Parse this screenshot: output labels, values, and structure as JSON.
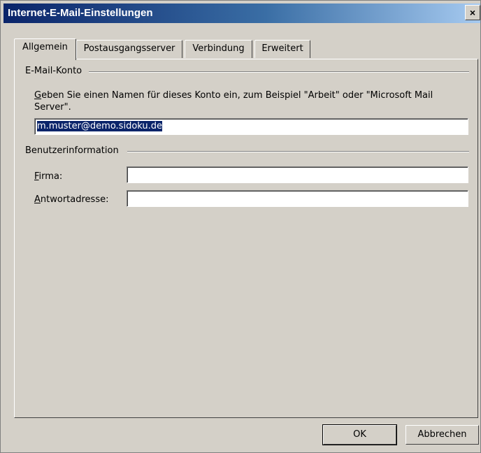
{
  "window": {
    "title": "Internet-E-Mail-Einstellungen",
    "close_symbol": "×"
  },
  "tabs": [
    {
      "label": "Allgemein",
      "active": true
    },
    {
      "label": "Postausgangsserver",
      "active": false
    },
    {
      "label": "Verbindung",
      "active": false
    },
    {
      "label": "Erweitert",
      "active": false
    }
  ],
  "account_group": {
    "label": "E-Mail-Konto",
    "description_first_letter": "G",
    "description_rest": "eben Sie einen Namen für dieses Konto ein, zum Beispiel \"Arbeit\" oder \"Microsoft Mail Server\".",
    "account_name_value": "m.muster@demo.sidoku.de"
  },
  "user_group": {
    "label": "Benutzerinformation",
    "company_label_first": "F",
    "company_label_rest": "irma:",
    "company_value": "",
    "reply_label_first": "A",
    "reply_label_rest": "ntwortadresse:",
    "reply_value": ""
  },
  "buttons": {
    "ok": "OK",
    "cancel": "Abbrechen"
  }
}
